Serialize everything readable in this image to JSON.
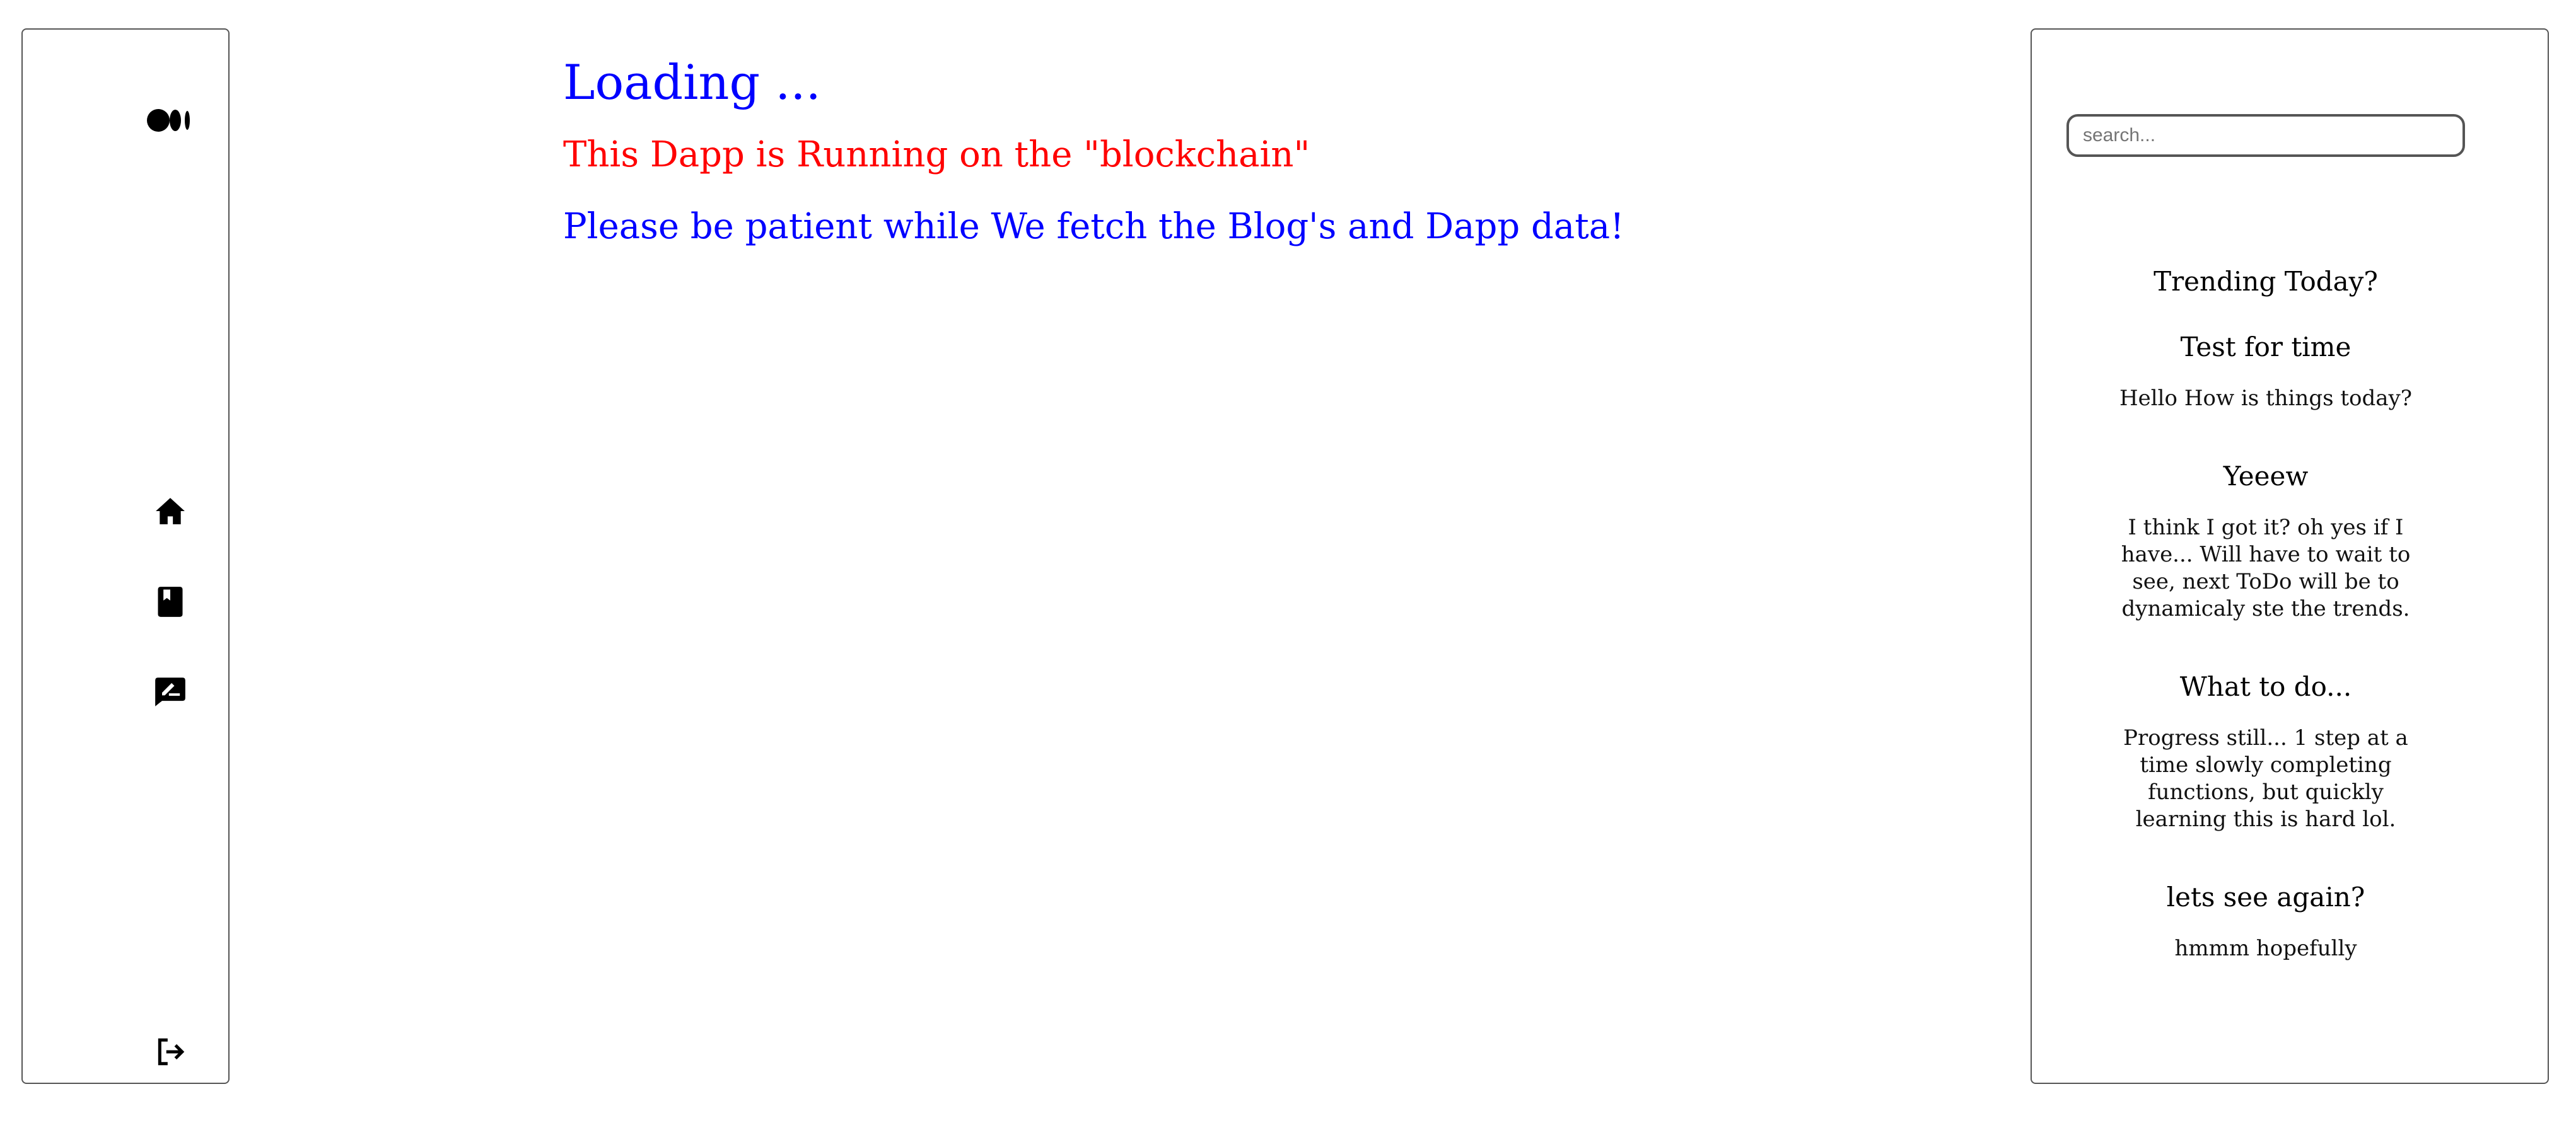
{
  "sidebar": {
    "logo_icon": "medium-logo-icon",
    "items": [
      {
        "name": "home",
        "icon": "home-icon"
      },
      {
        "name": "bookmarks",
        "icon": "book-icon"
      },
      {
        "name": "write",
        "icon": "rate-review-icon"
      }
    ],
    "logout_icon": "logout-icon"
  },
  "main": {
    "title": "Loading ...",
    "chain_notice": "This Dapp is Running on the \"blockchain\"",
    "patience_notice": "Please be patient while We fetch the Blog's and Dapp data!"
  },
  "rightbar": {
    "search": {
      "placeholder": "search...",
      "value": ""
    },
    "trending_title": "Trending Today?",
    "posts": [
      {
        "title": "Test for time",
        "body": "Hello How is things today?"
      },
      {
        "title": "Yeeew",
        "body": "I think I got it? oh yes if I have... Will have to wait to see, next ToDo will be to dynamicaly ste the trends."
      },
      {
        "title": "What to do...",
        "body": "Progress still... 1 step at a time slowly completing functions, but quickly learning this is hard lol."
      },
      {
        "title": "lets see again?",
        "body": "hmmm hopefully"
      }
    ]
  },
  "colors": {
    "title_blue": "#0000ff",
    "notice_red": "#ff0000",
    "border": "#555555"
  }
}
